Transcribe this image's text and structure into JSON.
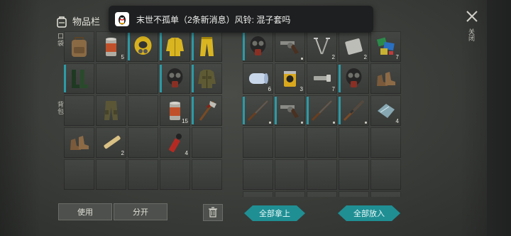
{
  "inventory": {
    "title": "物品栏",
    "side_label_top": "口袋",
    "side_label_bottom": "背包",
    "use_label": "使用",
    "split_label": "分开"
  },
  "storage": {
    "take_all_label": "全部拿上",
    "put_all_label": "全部放入"
  },
  "close": {
    "label": "关闭"
  },
  "toast": {
    "text": "末世不孤单（2条新消息）风铃: 混子套吗"
  },
  "left_rows": [
    [
      {
        "icon": "backpack-icon",
        "qty": "",
        "teal": false
      },
      {
        "icon": "canned-food-icon",
        "qty": "5",
        "teal": false
      },
      {
        "icon": "hazmat-hood-icon",
        "qty": "",
        "teal": true
      },
      {
        "icon": "hazmat-jacket-icon",
        "qty": "",
        "teal": true
      },
      {
        "icon": "hazmat-pants-icon",
        "qty": "",
        "teal": true
      }
    ],
    [
      {
        "icon": "rubber-boots-icon",
        "qty": "",
        "teal": true
      },
      {
        "icon": "",
        "qty": "",
        "teal": false
      },
      {
        "icon": "",
        "qty": "",
        "teal": false
      },
      {
        "icon": "gas-mask-icon",
        "qty": "",
        "teal": true
      },
      {
        "icon": "military-jacket-icon",
        "qty": "",
        "teal": true
      }
    ],
    [
      {
        "icon": "",
        "qty": "",
        "teal": false
      },
      {
        "icon": "cargo-pants-icon",
        "qty": "",
        "teal": false
      },
      {
        "icon": "",
        "qty": "",
        "teal": false
      },
      {
        "icon": "canned-food-icon",
        "qty": "15",
        "teal": false
      },
      {
        "icon": "fireman-axe-icon",
        "qty": "",
        "teal": true
      }
    ],
    [
      {
        "icon": "leather-boots-icon",
        "qty": "",
        "teal": false
      },
      {
        "icon": "bandage-icon",
        "qty": "2",
        "teal": false
      },
      {
        "icon": "",
        "qty": "",
        "teal": false
      },
      {
        "icon": "flare-icon",
        "qty": "4",
        "teal": false
      },
      {
        "icon": "",
        "qty": "",
        "teal": false
      }
    ],
    [
      {
        "icon": "",
        "qty": "",
        "teal": false
      },
      {
        "icon": "",
        "qty": "",
        "teal": false
      },
      {
        "icon": "",
        "qty": "",
        "teal": false
      },
      {
        "icon": "",
        "qty": "",
        "teal": false
      },
      {
        "icon": "",
        "qty": "",
        "teal": false
      }
    ]
  ],
  "right_rows": [
    [
      {
        "icon": "gas-mask-icon",
        "qty": "",
        "teal": true
      },
      {
        "icon": "revolver-icon",
        "qty": "dot",
        "teal": false
      },
      {
        "icon": "nails-icon",
        "qty": "2",
        "teal": false
      },
      {
        "icon": "metal-plate-icon",
        "qty": "2",
        "teal": false
      },
      {
        "icon": "fabric-scraps-icon",
        "qty": "7",
        "teal": false
      }
    ],
    [
      {
        "icon": "cloth-roll-icon",
        "qty": "6",
        "teal": false
      },
      {
        "icon": "oil-filter-icon",
        "qty": "3",
        "teal": false
      },
      {
        "icon": "screws-icon",
        "qty": "7",
        "teal": false
      },
      {
        "icon": "gas-mask-icon",
        "qty": "",
        "teal": true
      },
      {
        "icon": "leather-boots-icon",
        "qty": "",
        "teal": false
      }
    ],
    [
      {
        "icon": "shotgun-icon",
        "qty": "dot",
        "teal": true
      },
      {
        "icon": "revolver-icon",
        "qty": "dot",
        "teal": true
      },
      {
        "icon": "shotgun-icon",
        "qty": "dot",
        "teal": true
      },
      {
        "icon": "rifle-icon",
        "qty": "dot",
        "teal": true
      },
      {
        "icon": "glass-shards-icon",
        "qty": "4",
        "teal": false
      }
    ],
    [
      {
        "icon": "",
        "qty": "",
        "teal": false
      },
      {
        "icon": "",
        "qty": "",
        "teal": false
      },
      {
        "icon": "",
        "qty": "",
        "teal": false
      },
      {
        "icon": "",
        "qty": "",
        "teal": false
      },
      {
        "icon": "",
        "qty": "",
        "teal": false
      }
    ],
    [
      {
        "icon": "",
        "qty": "",
        "teal": false
      },
      {
        "icon": "",
        "qty": "",
        "teal": false
      },
      {
        "icon": "",
        "qty": "",
        "teal": false
      },
      {
        "icon": "",
        "qty": "",
        "teal": false
      },
      {
        "icon": "",
        "qty": "",
        "teal": false
      }
    ],
    [
      {
        "icon": "",
        "qty": "",
        "teal": false
      },
      {
        "icon": "",
        "qty": "",
        "teal": false
      },
      {
        "icon": "",
        "qty": "",
        "teal": false
      },
      {
        "icon": "",
        "qty": "",
        "teal": false
      },
      {
        "icon": "",
        "qty": "",
        "teal": false
      }
    ]
  ],
  "colors": {
    "accent_teal": "#1f8f94",
    "marker_teal": "#2c9aa6"
  }
}
